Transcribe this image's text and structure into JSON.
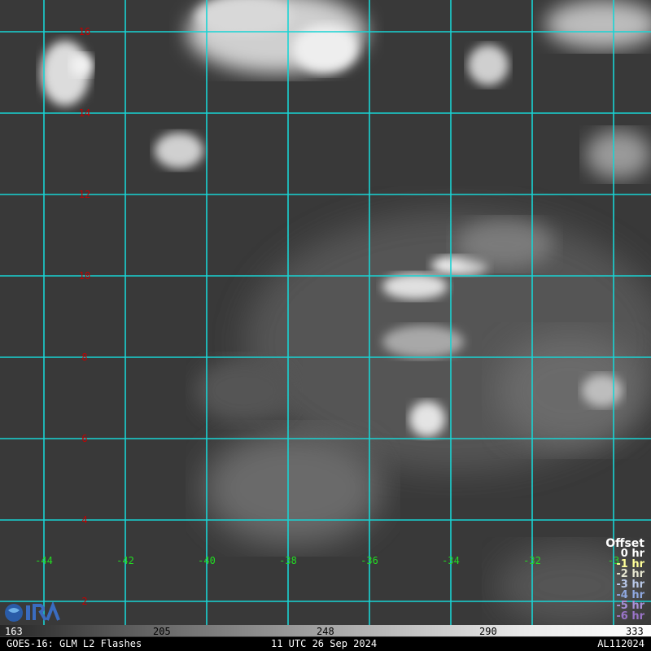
{
  "map": {
    "latitude_labels": [
      "16",
      "14",
      "12",
      "10",
      "8",
      "6",
      "4",
      "2"
    ],
    "longitude_labels": [
      "-44",
      "-42",
      "-40",
      "-38",
      "-36",
      "-34",
      "-32",
      "-3"
    ],
    "grid_color": "#19d4d4",
    "latitude_label_color": "#c40000",
    "longitude_label_color": "#22dd22"
  },
  "legend": {
    "title": "Offset",
    "items": [
      {
        "label": "0 hr",
        "color": "#ffffff"
      },
      {
        "label": "-1 hr",
        "color": "#ffff99"
      },
      {
        "label": "-2 hr",
        "color": "#e6e6d0"
      },
      {
        "label": "-3 hr",
        "color": "#b8c8e8"
      },
      {
        "label": "-4 hr",
        "color": "#8fa8e0"
      },
      {
        "label": "-5 hr",
        "color": "#a890d8"
      },
      {
        "label": "-6 hr",
        "color": "#9a74c8"
      }
    ]
  },
  "colorbar": {
    "ticks": [
      "163",
      "205",
      "248",
      "290",
      "333"
    ]
  },
  "footer": {
    "left": "GOES-16: GLM L2 Flashes",
    "center": "11 UTC 26 Sep 2024",
    "right": "AL112024"
  }
}
